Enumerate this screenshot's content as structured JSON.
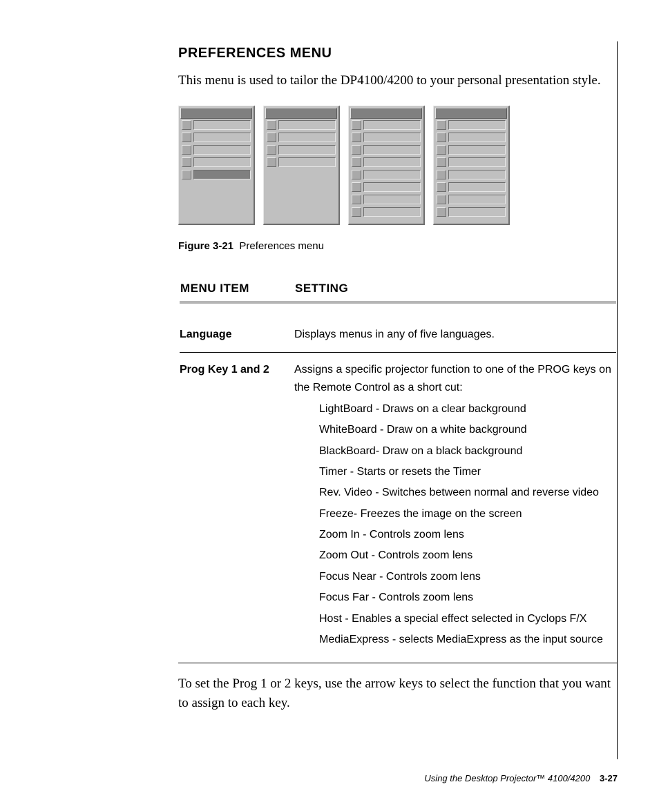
{
  "heading": "PREFERENCES MENU",
  "intro": "This menu is used to tailor the DP4100/4200 to your personal presentation style.",
  "figure": {
    "label": "Figure 3-21",
    "caption": "Preferences menu",
    "panels": [
      {
        "rows": 5,
        "selected_index": 4
      },
      {
        "rows": 4,
        "selected_index": -1
      },
      {
        "rows": 8,
        "selected_index": -1
      },
      {
        "rows": 8,
        "selected_index": -1
      }
    ]
  },
  "table": {
    "headers": {
      "item": "MENU ITEM",
      "setting": "SETTING"
    },
    "rows": [
      {
        "item": "Language",
        "setting": "Displays menus in any of five languages."
      },
      {
        "item": "Prog Key 1 and 2",
        "setting": "Assigns a specific projector function to one of the PROG keys on the Remote Control as a short cut:",
        "sub": [
          "LightBoard - Draws on a clear background",
          "WhiteBoard - Draw on a white background",
          "BlackBoard- Draw on a black background",
          "Timer - Starts or resets the Timer",
          "Rev. Video - Switches between normal and reverse video",
          "Freeze- Freezes the image on the screen",
          "Zoom In - Controls zoom lens",
          "Zoom Out - Controls zoom lens",
          "Focus Near - Controls zoom lens",
          "Focus Far - Controls zoom lens",
          "Host - Enables a special effect selected in Cyclops F/X",
          "MediaExpress - selects MediaExpress as the input source"
        ]
      }
    ]
  },
  "closing": "To set the Prog 1 or 2 keys, use the arrow keys to select the function that you want to assign to each key.",
  "footer": {
    "title": "Using the Desktop Projector™ 4100/4200",
    "page": "3-27"
  }
}
